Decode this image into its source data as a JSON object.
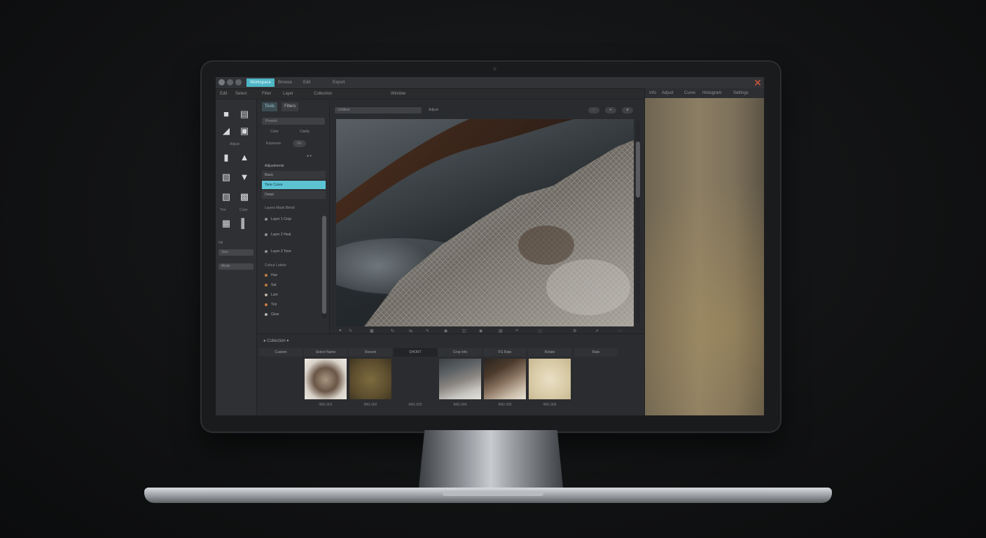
{
  "topbar": {
    "tabs": [
      {
        "label": "Workspace",
        "active": true
      },
      {
        "label": "Browse",
        "active": false
      },
      {
        "label": "Edit",
        "active": false
      },
      {
        "label": "Export",
        "active": false
      }
    ],
    "close_icon": "close-icon",
    "close_color": "#e05a3c"
  },
  "menubar": [
    "Edit",
    "Select",
    "Filter",
    "Layer",
    "Collection",
    "Window"
  ],
  "toolbox": {
    "section_label": "Adjust",
    "labels": [
      "Tint",
      "Color",
      "Fill"
    ],
    "fields": [
      "Size",
      "Mode"
    ]
  },
  "panel": {
    "tabs": [
      "Tools",
      "Filters"
    ],
    "preset_field": "Presets",
    "options": [
      "Color",
      "Clarity",
      "Exposure"
    ],
    "toggle_label": "On",
    "list_header": "Adjustments",
    "list_items": [
      {
        "label": "Basic",
        "selected": false
      },
      {
        "label": "Tone Curve",
        "selected": true
      },
      {
        "label": "Detail",
        "selected": false
      }
    ],
    "layers_header": "Layers Mask Blend",
    "layers": [
      "Layer 1 Crop",
      "Layer 2 Heal",
      "Layer 3 Tone"
    ],
    "swatch_header": "Colour Labels",
    "swatches": [
      {
        "label": "Hue",
        "color": "#c07d45"
      },
      {
        "label": "Sat",
        "color": "#c27a3f"
      },
      {
        "label": "Lum",
        "color": "#b9b1a2"
      },
      {
        "label": "Tint",
        "color": "#cf7a41"
      },
      {
        "label": "Glow",
        "color": "#b7b3ac"
      }
    ]
  },
  "viewport": {
    "file_field": "Untitled",
    "zoom_label": "Adjust",
    "pills": [
      "-",
      "+",
      "o"
    ]
  },
  "filmstrip": {
    "title": "Collection",
    "columns": [
      {
        "header": "Custom",
        "caption": "",
        "tone": "empty"
      },
      {
        "header": "Select Name",
        "caption": "IMG 001",
        "tone": "rock-light"
      },
      {
        "header": "Recent",
        "caption": "IMG 002",
        "tone": "olive"
      },
      {
        "header": "SHORT",
        "caption": "IMG 003",
        "tone": "empty"
      },
      {
        "header": "Crop Info",
        "caption": "IMG 004",
        "tone": "rock-cool"
      },
      {
        "header": "FG Rate",
        "caption": "IMG 005",
        "tone": "rock-warm"
      },
      {
        "header": "Rotate",
        "caption": "IMG 006",
        "tone": "cream"
      },
      {
        "header": "Rate",
        "caption": "",
        "tone": "empty"
      }
    ]
  },
  "right_panel": {
    "tabs": [
      "Info",
      "Adjust",
      "Curve",
      "Histogram",
      "Settings"
    ]
  }
}
